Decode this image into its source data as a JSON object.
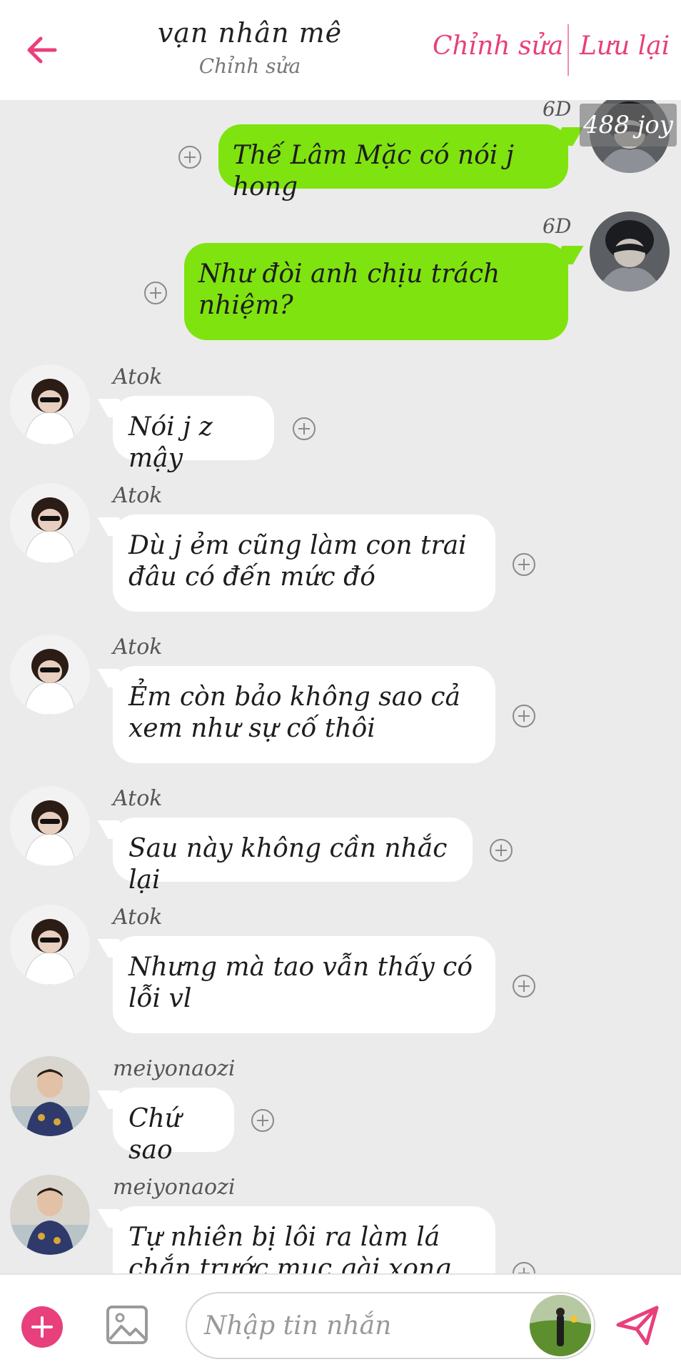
{
  "header": {
    "title": "vạn nhân mê",
    "subtitle": "Chỉnh sửa",
    "edit_label": "Chỉnh sửa",
    "save_label": "Lưu lại",
    "accent_color": "#e8407c"
  },
  "joy_badge": "488 joy",
  "messages": [
    {
      "side": "out",
      "tag": "6D",
      "text": "Thế Lâm Mặc có nói j hong"
    },
    {
      "side": "out",
      "tag": "6D",
      "text": "Như đòi anh chịu trách nhiệm?"
    },
    {
      "side": "in",
      "sender": "Atok",
      "text": "Nói j z mậy"
    },
    {
      "side": "in",
      "sender": "Atok",
      "text": "Dù j ẻm cũng làm con trai đâu có đến mức đó"
    },
    {
      "side": "in",
      "sender": "Atok",
      "text": "Ẻm còn bảo không sao cả xem như sự cố thôi"
    },
    {
      "side": "in",
      "sender": "Atok",
      "text": "Sau này không cần nhắc lại"
    },
    {
      "side": "in",
      "sender": "Atok",
      "text": "Nhưng mà tao vẫn thấy có lỗi vl"
    },
    {
      "side": "in",
      "sender": "meiyonaozi",
      "text": "Chứ sao"
    },
    {
      "side": "in",
      "sender": "meiyonaozi",
      "text": "Tự nhiên bị lôi ra làm lá chắn trước mục gài xong bị ăn sạch"
    }
  ],
  "input_bar": {
    "placeholder": "Nhập tin nhắn"
  },
  "icons": {
    "back": "arrow-left-icon",
    "add": "plus-circle-icon",
    "image": "image-icon",
    "send": "send-icon"
  },
  "colors": {
    "outgoing_bubble": "#7fe30f",
    "incoming_bubble": "#ffffff",
    "background": "#ebebeb"
  }
}
